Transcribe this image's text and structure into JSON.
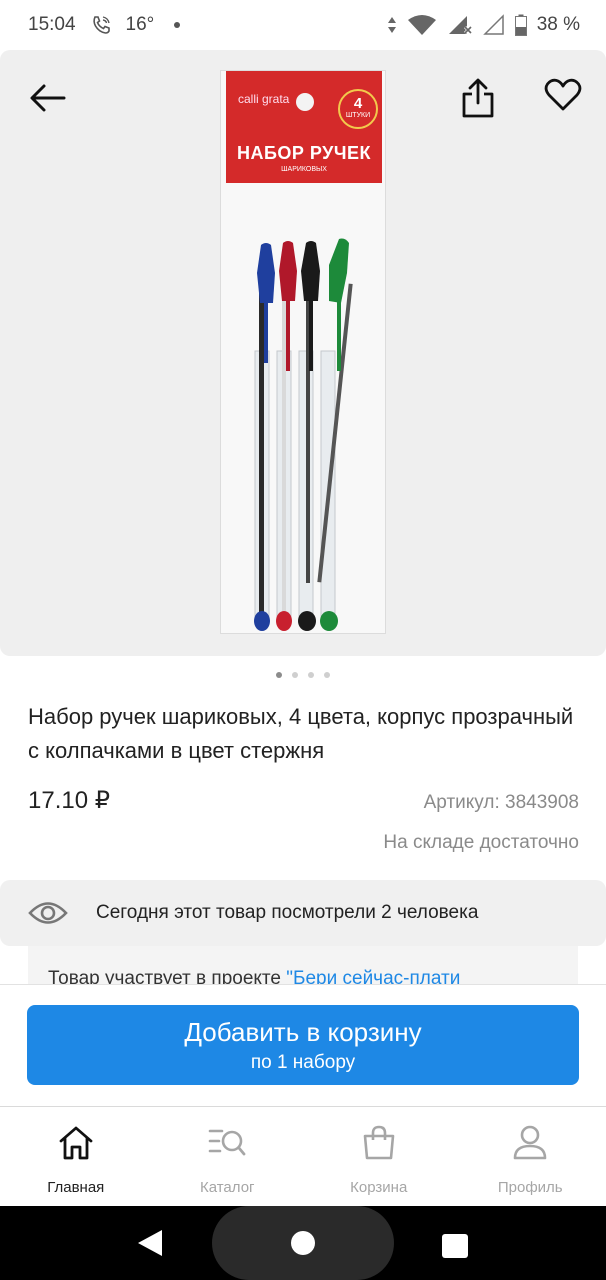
{
  "status_bar": {
    "time": "15:04",
    "temperature": "16°",
    "battery": "38 %"
  },
  "product": {
    "package": {
      "brand": "calli grata",
      "count_number": "4",
      "count_word": "ШТУКИ",
      "title": "НАБОР РУЧЕК",
      "subtitle": "ШАРИКОВЫХ"
    },
    "image_count": 4,
    "active_image": 1,
    "title": "Набор ручек шариковых, 4 цвета, корпус прозрачный с колпачками в цвет стержня",
    "price": "17.10 ₽",
    "sku_label": "Артикул:",
    "sku_value": "3843908",
    "stock": "На складе достаточно"
  },
  "views": {
    "text": "Сегодня этот товар посмотрели 2 человека"
  },
  "promo": {
    "text": "Товар участвует в проекте ",
    "link": "\"Бери сейчас-плати"
  },
  "cart_button": {
    "label": "Добавить в корзину",
    "sublabel": "по 1 набору"
  },
  "bottom_nav": {
    "items": [
      {
        "label": "Главная",
        "icon": "home-icon",
        "active": true
      },
      {
        "label": "Каталог",
        "icon": "catalog-search-icon",
        "active": false
      },
      {
        "label": "Корзина",
        "icon": "cart-bag-icon",
        "active": false
      },
      {
        "label": "Профиль",
        "icon": "profile-icon",
        "active": false
      }
    ]
  },
  "colors": {
    "accent": "#1e88e5",
    "package_red": "#d42a2a",
    "pen_blue": "#1f3f9e",
    "pen_red": "#b0182a",
    "pen_black": "#1a1a1a",
    "pen_green": "#1d8a3a"
  }
}
